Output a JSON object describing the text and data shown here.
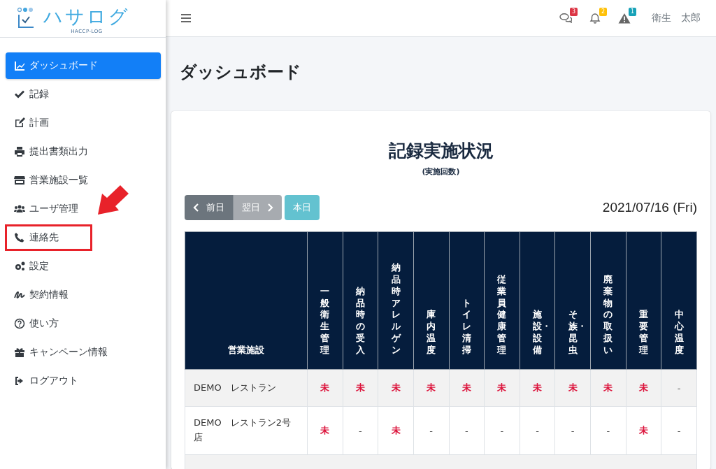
{
  "logo": {
    "name": "ハサログ",
    "subtitle": "HACCP-LOG"
  },
  "sidebar": {
    "items": [
      {
        "label": "ダッシュボード",
        "kind": "chart",
        "selected": true,
        "highlighted": false
      },
      {
        "label": "記録",
        "kind": "check",
        "selected": false,
        "highlighted": false
      },
      {
        "label": "計画",
        "kind": "edit",
        "selected": false,
        "highlighted": false
      },
      {
        "label": "提出書類出力",
        "kind": "print",
        "selected": false,
        "highlighted": false
      },
      {
        "label": "営業施設一覧",
        "kind": "store",
        "selected": false,
        "highlighted": false
      },
      {
        "label": "ユーザ管理",
        "kind": "users",
        "selected": false,
        "highlighted": false
      },
      {
        "label": "連絡先",
        "kind": "phone",
        "selected": false,
        "highlighted": true
      },
      {
        "label": "設定",
        "kind": "gears",
        "selected": false,
        "highlighted": false
      },
      {
        "label": "契約情報",
        "kind": "signature",
        "selected": false,
        "highlighted": false
      },
      {
        "label": "使い方",
        "kind": "question",
        "selected": false,
        "highlighted": false
      },
      {
        "label": "キャンペーン情報",
        "kind": "gift",
        "selected": false,
        "highlighted": false
      },
      {
        "label": "ログアウト",
        "kind": "logout",
        "selected": false,
        "highlighted": false
      }
    ]
  },
  "topbar": {
    "notifications": [
      {
        "kind": "comments",
        "count": "3",
        "color": "#dc3545"
      },
      {
        "kind": "bell",
        "count": "2",
        "color": "#ffc107"
      },
      {
        "kind": "warning",
        "count": "1",
        "color": "#17a2b8"
      }
    ],
    "user": "衛生　太郎"
  },
  "page_title": "ダッシュボード",
  "card": {
    "title": "記録実施状況",
    "subtitle": "(実施回数)",
    "nav_buttons": [
      {
        "label": "前日",
        "kind": "prev",
        "disabled": false
      },
      {
        "label": "翌日",
        "kind": "next",
        "disabled": true
      },
      {
        "label": "本日",
        "kind": "today",
        "disabled": false
      }
    ],
    "date": "2021/07/16 (Fri)",
    "table": {
      "columns": [
        "営業施設",
        "一般衛生管理",
        "納品時の受入",
        "納品時アレルゲン",
        "庫内温度",
        "トイレ清掃",
        "従業員健康管理",
        "施設・設備",
        "そ族・昆虫",
        "廃棄物の取扱い",
        "重要管理",
        "中心温度"
      ],
      "rows": [
        {
          "cells": [
            {
              "text": "DEMO　レストラン",
              "kind": "facility"
            },
            {
              "text": "未",
              "kind": "pending"
            },
            {
              "text": "未",
              "kind": "pending"
            },
            {
              "text": "未",
              "kind": "pending"
            },
            {
              "text": "未",
              "kind": "pending"
            },
            {
              "text": "未",
              "kind": "pending"
            },
            {
              "text": "未",
              "kind": "pending"
            },
            {
              "text": "未",
              "kind": "pending"
            },
            {
              "text": "未",
              "kind": "pending"
            },
            {
              "text": "未",
              "kind": "pending"
            },
            {
              "text": "未",
              "kind": "pending"
            },
            {
              "text": "-",
              "kind": "none"
            }
          ]
        },
        {
          "cells": [
            {
              "text": "DEMO　レストラン2号店",
              "kind": "facility"
            },
            {
              "text": "未",
              "kind": "pending"
            },
            {
              "text": "-",
              "kind": "none"
            },
            {
              "text": "未",
              "kind": "pending"
            },
            {
              "text": "-",
              "kind": "none"
            },
            {
              "text": "-",
              "kind": "none"
            },
            {
              "text": "-",
              "kind": "none"
            },
            {
              "text": "-",
              "kind": "none"
            },
            {
              "text": "-",
              "kind": "none"
            },
            {
              "text": "-",
              "kind": "none"
            },
            {
              "text": "未",
              "kind": "pending"
            },
            {
              "text": "-",
              "kind": "none"
            }
          ]
        }
      ]
    }
  }
}
